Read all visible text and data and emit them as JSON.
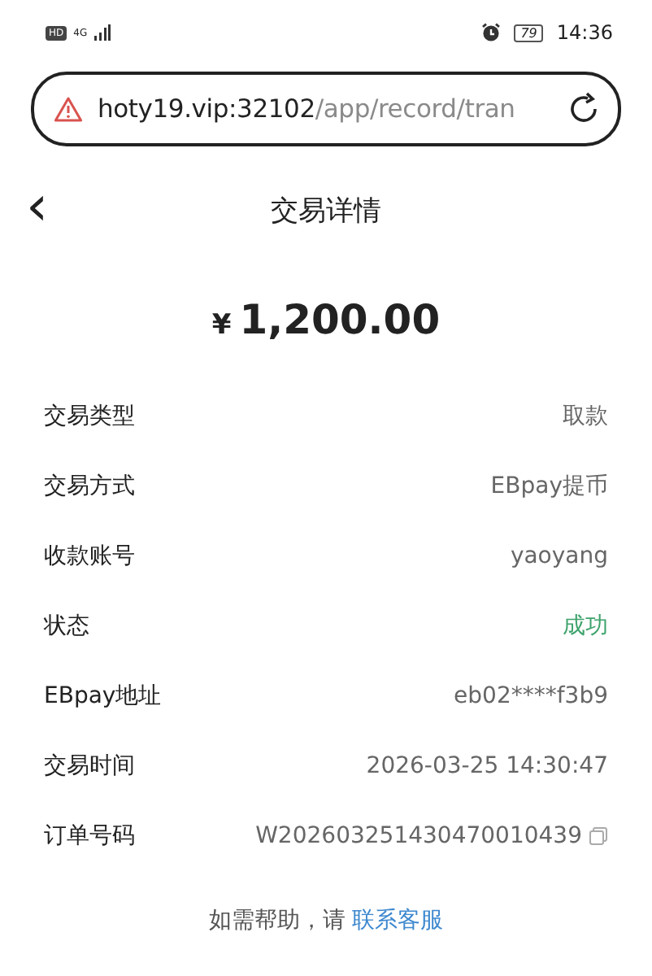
{
  "status_bar": {
    "hd": "HD",
    "network": "4G",
    "battery": "79",
    "time": "14:36"
  },
  "address_bar": {
    "host": "hoty19.vip:32102",
    "path": "/app/record/tran"
  },
  "header": {
    "back": "‹",
    "title": "交易详情"
  },
  "amount": {
    "currency": "¥",
    "value": "1,200.00"
  },
  "details": [
    {
      "label": "交易类型",
      "value": "取款",
      "kind": "plain"
    },
    {
      "label": "交易方式",
      "value": "EBpay提币",
      "kind": "plain"
    },
    {
      "label": "收款账号",
      "value": "yaoyang",
      "kind": "plain"
    },
    {
      "label": "状态",
      "value": "成功",
      "kind": "success"
    },
    {
      "label": "EBpay地址",
      "value": "eb02****f3b9",
      "kind": "plain"
    },
    {
      "label": "交易时间",
      "value": "2026-03-25 14:30:47",
      "kind": "plain"
    },
    {
      "label": "订单号码",
      "value": "W202603251430470010439",
      "kind": "copyable"
    }
  ],
  "help": {
    "text": "如需帮助，请",
    "link": "联系客服"
  }
}
